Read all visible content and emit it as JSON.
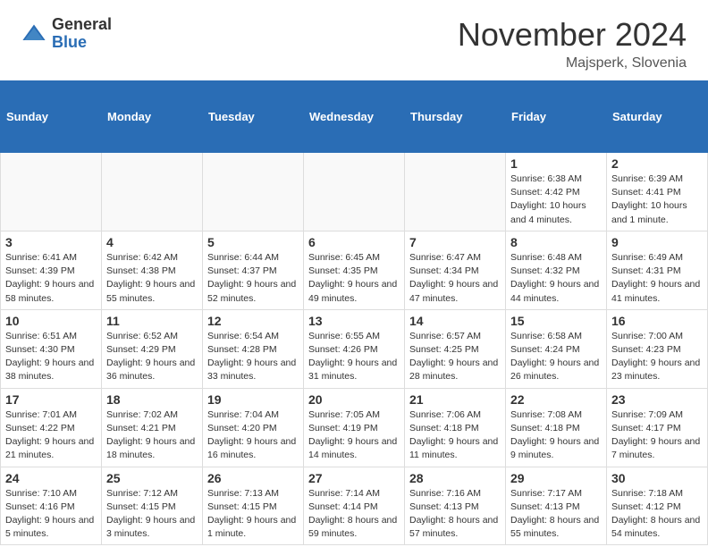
{
  "logo": {
    "general": "General",
    "blue": "Blue"
  },
  "title": "November 2024",
  "location": "Majsperk, Slovenia",
  "weekdays": [
    "Sunday",
    "Monday",
    "Tuesday",
    "Wednesday",
    "Thursday",
    "Friday",
    "Saturday"
  ],
  "weeks": [
    [
      {
        "day": "",
        "sunrise": "",
        "sunset": "",
        "daylight": "",
        "empty": true
      },
      {
        "day": "",
        "sunrise": "",
        "sunset": "",
        "daylight": "",
        "empty": true
      },
      {
        "day": "",
        "sunrise": "",
        "sunset": "",
        "daylight": "",
        "empty": true
      },
      {
        "day": "",
        "sunrise": "",
        "sunset": "",
        "daylight": "",
        "empty": true
      },
      {
        "day": "",
        "sunrise": "",
        "sunset": "",
        "daylight": "",
        "empty": true
      },
      {
        "day": "1",
        "sunrise": "Sunrise: 6:38 AM",
        "sunset": "Sunset: 4:42 PM",
        "daylight": "Daylight: 10 hours and 4 minutes.",
        "empty": false
      },
      {
        "day": "2",
        "sunrise": "Sunrise: 6:39 AM",
        "sunset": "Sunset: 4:41 PM",
        "daylight": "Daylight: 10 hours and 1 minute.",
        "empty": false
      }
    ],
    [
      {
        "day": "3",
        "sunrise": "Sunrise: 6:41 AM",
        "sunset": "Sunset: 4:39 PM",
        "daylight": "Daylight: 9 hours and 58 minutes.",
        "empty": false
      },
      {
        "day": "4",
        "sunrise": "Sunrise: 6:42 AM",
        "sunset": "Sunset: 4:38 PM",
        "daylight": "Daylight: 9 hours and 55 minutes.",
        "empty": false
      },
      {
        "day": "5",
        "sunrise": "Sunrise: 6:44 AM",
        "sunset": "Sunset: 4:37 PM",
        "daylight": "Daylight: 9 hours and 52 minutes.",
        "empty": false
      },
      {
        "day": "6",
        "sunrise": "Sunrise: 6:45 AM",
        "sunset": "Sunset: 4:35 PM",
        "daylight": "Daylight: 9 hours and 49 minutes.",
        "empty": false
      },
      {
        "day": "7",
        "sunrise": "Sunrise: 6:47 AM",
        "sunset": "Sunset: 4:34 PM",
        "daylight": "Daylight: 9 hours and 47 minutes.",
        "empty": false
      },
      {
        "day": "8",
        "sunrise": "Sunrise: 6:48 AM",
        "sunset": "Sunset: 4:32 PM",
        "daylight": "Daylight: 9 hours and 44 minutes.",
        "empty": false
      },
      {
        "day": "9",
        "sunrise": "Sunrise: 6:49 AM",
        "sunset": "Sunset: 4:31 PM",
        "daylight": "Daylight: 9 hours and 41 minutes.",
        "empty": false
      }
    ],
    [
      {
        "day": "10",
        "sunrise": "Sunrise: 6:51 AM",
        "sunset": "Sunset: 4:30 PM",
        "daylight": "Daylight: 9 hours and 38 minutes.",
        "empty": false
      },
      {
        "day": "11",
        "sunrise": "Sunrise: 6:52 AM",
        "sunset": "Sunset: 4:29 PM",
        "daylight": "Daylight: 9 hours and 36 minutes.",
        "empty": false
      },
      {
        "day": "12",
        "sunrise": "Sunrise: 6:54 AM",
        "sunset": "Sunset: 4:28 PM",
        "daylight": "Daylight: 9 hours and 33 minutes.",
        "empty": false
      },
      {
        "day": "13",
        "sunrise": "Sunrise: 6:55 AM",
        "sunset": "Sunset: 4:26 PM",
        "daylight": "Daylight: 9 hours and 31 minutes.",
        "empty": false
      },
      {
        "day": "14",
        "sunrise": "Sunrise: 6:57 AM",
        "sunset": "Sunset: 4:25 PM",
        "daylight": "Daylight: 9 hours and 28 minutes.",
        "empty": false
      },
      {
        "day": "15",
        "sunrise": "Sunrise: 6:58 AM",
        "sunset": "Sunset: 4:24 PM",
        "daylight": "Daylight: 9 hours and 26 minutes.",
        "empty": false
      },
      {
        "day": "16",
        "sunrise": "Sunrise: 7:00 AM",
        "sunset": "Sunset: 4:23 PM",
        "daylight": "Daylight: 9 hours and 23 minutes.",
        "empty": false
      }
    ],
    [
      {
        "day": "17",
        "sunrise": "Sunrise: 7:01 AM",
        "sunset": "Sunset: 4:22 PM",
        "daylight": "Daylight: 9 hours and 21 minutes.",
        "empty": false
      },
      {
        "day": "18",
        "sunrise": "Sunrise: 7:02 AM",
        "sunset": "Sunset: 4:21 PM",
        "daylight": "Daylight: 9 hours and 18 minutes.",
        "empty": false
      },
      {
        "day": "19",
        "sunrise": "Sunrise: 7:04 AM",
        "sunset": "Sunset: 4:20 PM",
        "daylight": "Daylight: 9 hours and 16 minutes.",
        "empty": false
      },
      {
        "day": "20",
        "sunrise": "Sunrise: 7:05 AM",
        "sunset": "Sunset: 4:19 PM",
        "daylight": "Daylight: 9 hours and 14 minutes.",
        "empty": false
      },
      {
        "day": "21",
        "sunrise": "Sunrise: 7:06 AM",
        "sunset": "Sunset: 4:18 PM",
        "daylight": "Daylight: 9 hours and 11 minutes.",
        "empty": false
      },
      {
        "day": "22",
        "sunrise": "Sunrise: 7:08 AM",
        "sunset": "Sunset: 4:18 PM",
        "daylight": "Daylight: 9 hours and 9 minutes.",
        "empty": false
      },
      {
        "day": "23",
        "sunrise": "Sunrise: 7:09 AM",
        "sunset": "Sunset: 4:17 PM",
        "daylight": "Daylight: 9 hours and 7 minutes.",
        "empty": false
      }
    ],
    [
      {
        "day": "24",
        "sunrise": "Sunrise: 7:10 AM",
        "sunset": "Sunset: 4:16 PM",
        "daylight": "Daylight: 9 hours and 5 minutes.",
        "empty": false
      },
      {
        "day": "25",
        "sunrise": "Sunrise: 7:12 AM",
        "sunset": "Sunset: 4:15 PM",
        "daylight": "Daylight: 9 hours and 3 minutes.",
        "empty": false
      },
      {
        "day": "26",
        "sunrise": "Sunrise: 7:13 AM",
        "sunset": "Sunset: 4:15 PM",
        "daylight": "Daylight: 9 hours and 1 minute.",
        "empty": false
      },
      {
        "day": "27",
        "sunrise": "Sunrise: 7:14 AM",
        "sunset": "Sunset: 4:14 PM",
        "daylight": "Daylight: 8 hours and 59 minutes.",
        "empty": false
      },
      {
        "day": "28",
        "sunrise": "Sunrise: 7:16 AM",
        "sunset": "Sunset: 4:13 PM",
        "daylight": "Daylight: 8 hours and 57 minutes.",
        "empty": false
      },
      {
        "day": "29",
        "sunrise": "Sunrise: 7:17 AM",
        "sunset": "Sunset: 4:13 PM",
        "daylight": "Daylight: 8 hours and 55 minutes.",
        "empty": false
      },
      {
        "day": "30",
        "sunrise": "Sunrise: 7:18 AM",
        "sunset": "Sunset: 4:12 PM",
        "daylight": "Daylight: 8 hours and 54 minutes.",
        "empty": false
      }
    ]
  ]
}
